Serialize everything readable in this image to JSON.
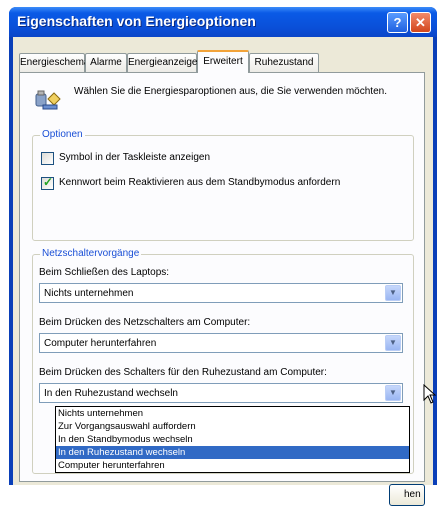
{
  "window": {
    "title": "Eigenschaften von Energieoptionen"
  },
  "tabs": [
    {
      "label": "Energieschemas",
      "active": false
    },
    {
      "label": "Alarme",
      "active": false
    },
    {
      "label": "Energieanzeige",
      "active": false
    },
    {
      "label": "Erweitert",
      "active": true
    },
    {
      "label": "Ruhezustand",
      "active": false
    }
  ],
  "intro": {
    "text": "Wählen Sie die Energiesparoptionen aus, die Sie verwenden möchten."
  },
  "options_group": {
    "label": "Optionen",
    "checkboxes": [
      {
        "label": "Symbol in der Taskleiste anzeigen",
        "checked": false
      },
      {
        "label": "Kennwort beim Reaktivieren aus dem Standbymodus anfordern",
        "checked": true
      }
    ]
  },
  "power_buttons_group": {
    "label": "Netzschaltervorgänge",
    "lid_label": "Beim Schließen des Laptops:",
    "lid_value": "Nichts unternehmen",
    "power_label": "Beim Drücken des Netzschalters am Computer:",
    "power_value": "Computer herunterfahren",
    "sleep_label": "Beim Drücken des Schalters für den Ruhezustand am Computer:",
    "sleep_value": "In den Ruhezustand wechseln"
  },
  "dropdown": {
    "options": [
      "Nichts unternehmen",
      "Zur Vorgangsauswahl auffordern",
      "In den Standbymodus wechseln",
      "In den Ruhezustand wechseln",
      "Computer herunterfahren"
    ],
    "selected_index": 3
  },
  "footer": {
    "partial_button_text": "hen"
  },
  "colors": {
    "title_blue": "#0a4fd8",
    "group_label_blue": "#1a4fd6",
    "selection": "#316ac5"
  },
  "icons": [
    "help-icon",
    "close-icon",
    "power-options-icon",
    "chevron-down-icon",
    "check-icon",
    "mouse-pointer-icon"
  ]
}
